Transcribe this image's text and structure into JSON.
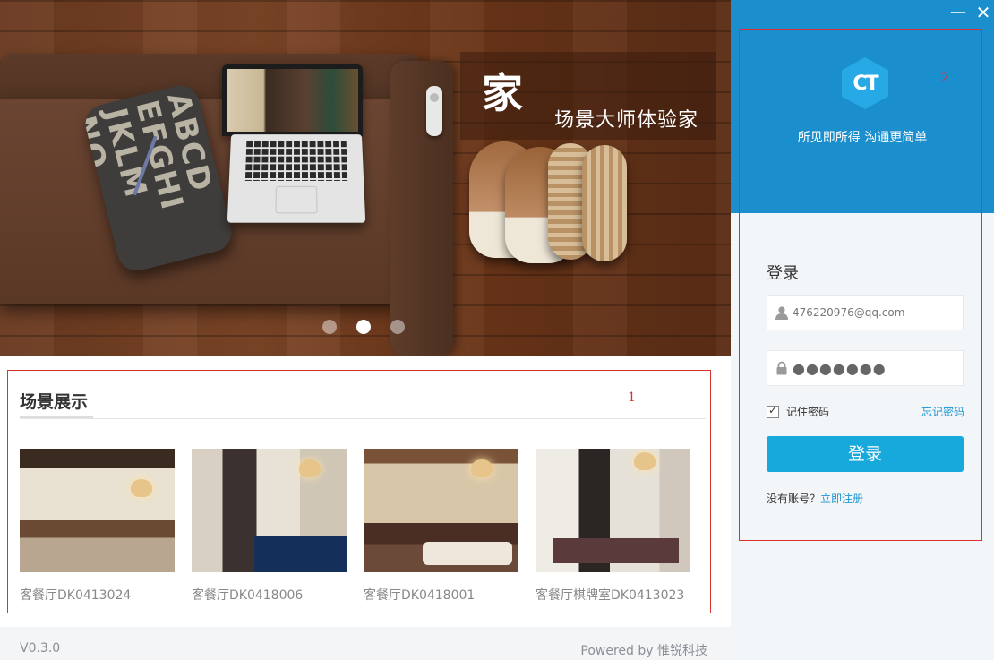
{
  "banner": {
    "caption_big": "家",
    "caption_small": "场景大师体验家",
    "pillow_text": "ABCDEFGHIJKLMNO",
    "carousel": {
      "count": 3,
      "active": 2
    }
  },
  "scenes": {
    "title": "场景展示",
    "box_number": "1",
    "items": [
      {
        "caption": "客餐厅DK0413024"
      },
      {
        "caption": "客餐厅DK0418006"
      },
      {
        "caption": "客餐厅DK0418001"
      },
      {
        "caption": "客餐厅棋牌室DK0413023"
      }
    ]
  },
  "footer": {
    "version": "V0.3.0",
    "powered": "Powered by 惟锐科技"
  },
  "window": {
    "minimize": "—",
    "close": "✕"
  },
  "login": {
    "box_number": "2",
    "logo_text": "CT",
    "slogan": "所见即所得 沟通更简单",
    "heading": "登录",
    "username_value": "476220976@qq.com",
    "password_value": "●●●●●●●",
    "remember_label": "记住密码",
    "remember_checked": true,
    "forgot_label": "忘记密码",
    "submit_label": "登录",
    "no_account_text": "没有账号？",
    "register_label": "立即注册"
  },
  "colors": {
    "brand_blue": "#1b8fcd",
    "button_blue": "#17a9dc",
    "link_blue": "#1b95d3",
    "annotation_red": "#d9322f"
  }
}
